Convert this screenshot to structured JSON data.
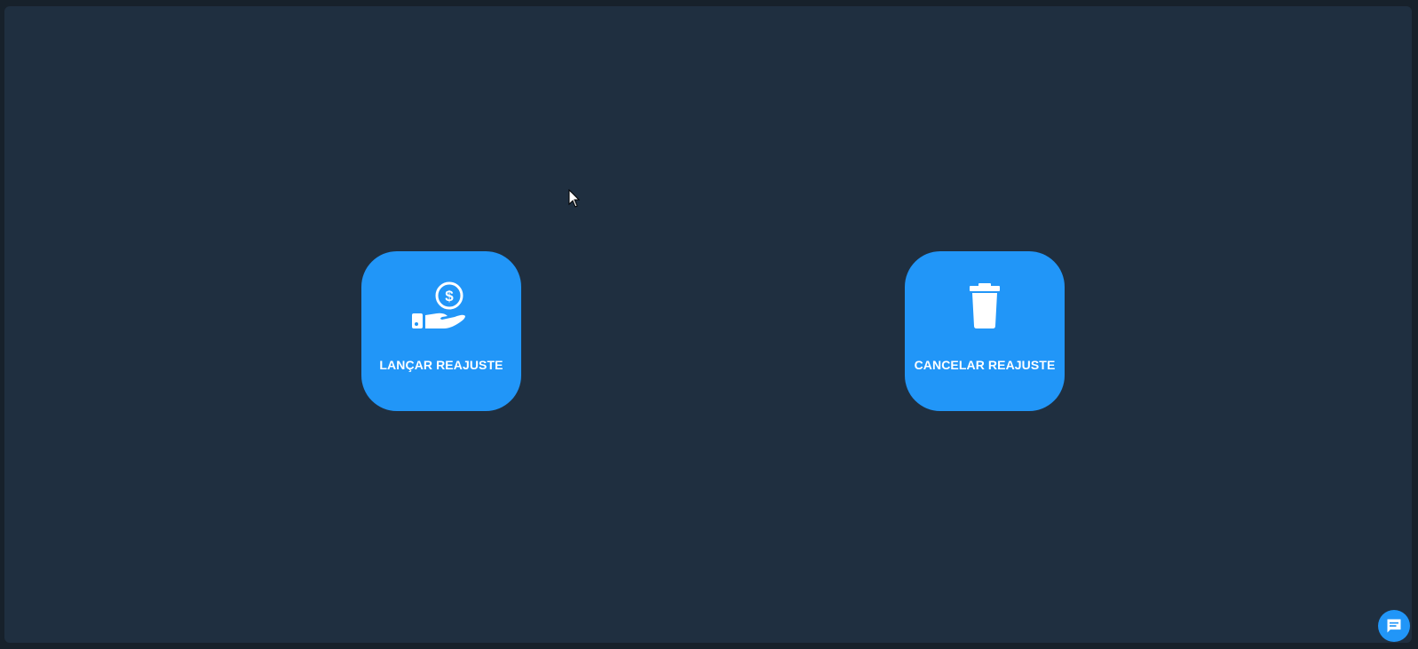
{
  "actions": [
    {
      "label": "LANÇAR REAJUSTE",
      "icon": "hand-coin-icon"
    },
    {
      "label": "CANCELAR REAJUSTE",
      "icon": "trash-icon"
    }
  ],
  "chat": {
    "icon": "chat-icon"
  },
  "colors": {
    "background": "#1f2f40",
    "outer": "#17212b",
    "accent": "#2196f8",
    "text": "#ffffff"
  }
}
